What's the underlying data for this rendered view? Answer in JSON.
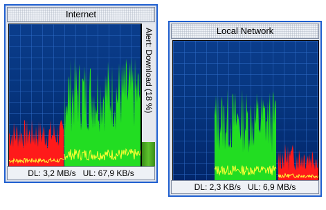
{
  "colors": {
    "download": "#ff1a1a",
    "upload": "#22dd22",
    "grid": "#2f6cc8",
    "peak": "#ffff33"
  },
  "internet": {
    "title": "Internet",
    "status_dl": "DL: 3,2 MB/s",
    "status_ul": "UL: 67,9 KB/s",
    "alert_text": "Alert: Download (18 %)",
    "alert_level": 0.18
  },
  "local": {
    "title": "Local Network",
    "status_dl": "DL: 2,3 KB/s",
    "status_ul": "UL: 6,9 MB/s"
  }
}
